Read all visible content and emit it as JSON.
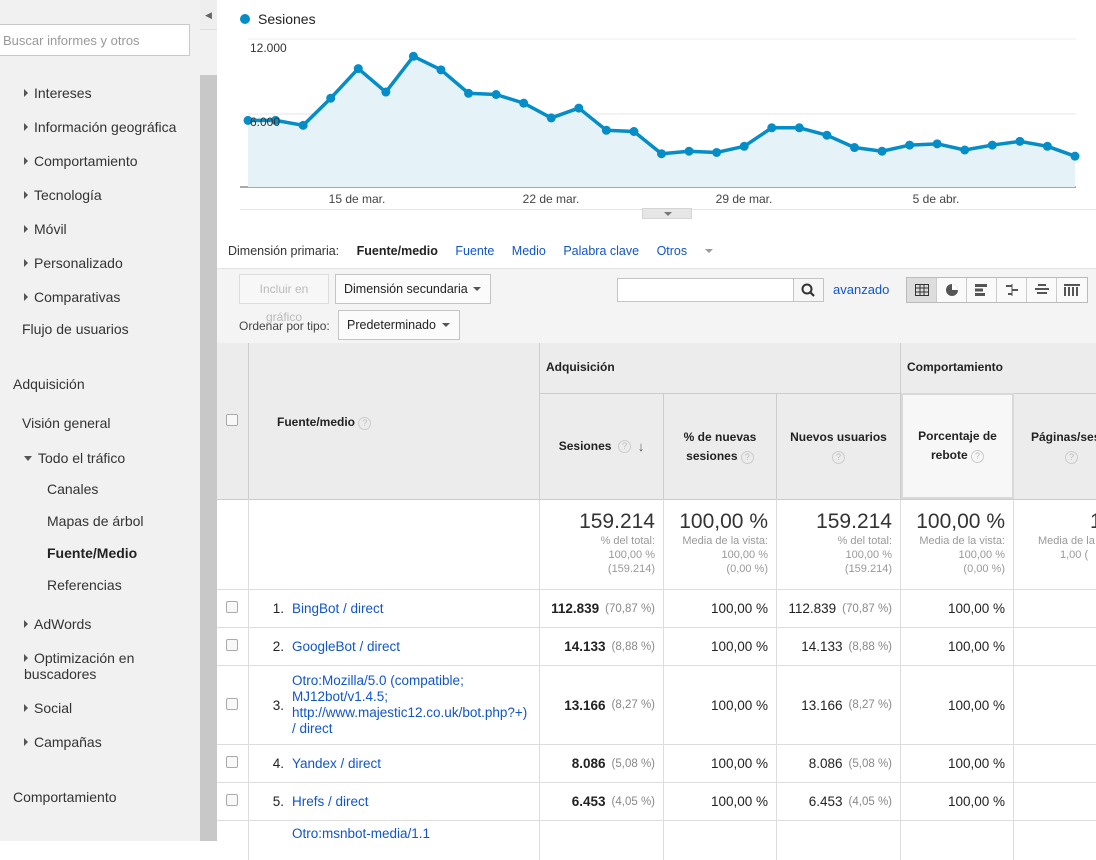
{
  "sidebar": {
    "search_placeholder": "Buscar informes y otros",
    "items": [
      {
        "label": "Intereses"
      },
      {
        "label": "Información geográfica"
      },
      {
        "label": "Comportamiento"
      },
      {
        "label": "Tecnología"
      },
      {
        "label": "Móvil"
      },
      {
        "label": "Personalizado"
      },
      {
        "label": "Comparativas"
      },
      {
        "label": "Flujo de usuarios"
      },
      {
        "label": "Adquisición"
      },
      {
        "label": "Visión general"
      },
      {
        "label": "Todo el tráfico"
      },
      {
        "label": "Canales"
      },
      {
        "label": "Mapas de árbol"
      },
      {
        "label": "Fuente/Medio"
      },
      {
        "label": "Referencias"
      },
      {
        "label": "AdWords"
      },
      {
        "label": "Optimización en buscadores"
      },
      {
        "label": "Social"
      },
      {
        "label": "Campañas"
      },
      {
        "label": "Comportamiento"
      }
    ]
  },
  "chart": {
    "legend": "Sesiones",
    "series_color": "#058dc7",
    "y_ticks": [
      "12.000",
      "6.000"
    ],
    "x_ticks": [
      "15 de mar.",
      "22 de mar.",
      "29 de mar.",
      "5 de abr."
    ]
  },
  "chart_data": {
    "type": "area",
    "series": [
      {
        "name": "Sesiones",
        "values": [
          5400,
          5400,
          5000,
          7200,
          9600,
          7700,
          10600,
          9500,
          7600,
          7500,
          6800,
          5600,
          6400,
          4600,
          4500,
          2700,
          2900,
          2800,
          3300,
          4800,
          4800,
          4200,
          3200,
          2900,
          3400,
          3500,
          3000,
          3400,
          3700,
          3300,
          2500
        ]
      }
    ],
    "x_tick_labels": [
      "15 de mar.",
      "22 de mar.",
      "29 de mar.",
      "5 de abr."
    ],
    "ylim": [
      0,
      12000
    ],
    "y_tick_labels": [
      "6.000",
      "12.000"
    ],
    "grid": true
  },
  "dimension": {
    "label": "Dimensión primaria:",
    "active": "Fuente/medio",
    "links": [
      "Fuente",
      "Medio",
      "Palabra clave",
      "Otros"
    ]
  },
  "toolbar": {
    "plot_button": "Incluir en gráfico",
    "secondary_dimension": "Dimensión secundaria",
    "advanced": "avanzado",
    "sort_label": "Ordenar por tipo:",
    "sort_value": "Predeterminado"
  },
  "table": {
    "group_acquisition": "Adquisición",
    "group_behavior": "Comportamiento",
    "col_source": "Fuente/medio",
    "col_sessions": "Sesiones",
    "col_new_pct_1": "% de nuevas",
    "col_new_pct_2": "sesiones",
    "col_new_users": "Nuevos usuarios",
    "col_bounce_1": "Porcentaje de",
    "col_bounce_2": "rebote",
    "col_pages": "Páginas/ses",
    "totals": {
      "sessions": "159.214",
      "sessions_sub1": "% del total:",
      "sessions_sub2": "100,00 %",
      "sessions_sub3": "(159.214)",
      "new_pct": "100,00 %",
      "new_pct_sub1": "Media de la vista:",
      "new_pct_sub2": "100,00 %",
      "new_pct_sub3": "(0,00 %)",
      "new_users": "159.214",
      "new_users_sub1": "% del total:",
      "new_users_sub2": "100,00 %",
      "new_users_sub3": "(159.214)",
      "bounce": "100,00 %",
      "bounce_sub1": "Media de la vista:",
      "bounce_sub2": "100,00 %",
      "bounce_sub3": "(0,00 %)",
      "pages": "1",
      "pages_sub1": "Media de la",
      "pages_sub2": "1,00 ("
    },
    "rows": [
      {
        "idx": "1.",
        "source": "BingBot / direct",
        "sessions": "112.839",
        "sessions_pct": "(70,87 %)",
        "new_pct": "100,00 %",
        "new_users": "112.839",
        "new_users_pct": "(70,87 %)",
        "bounce": "100,00 %"
      },
      {
        "idx": "2.",
        "source": "GoogleBot / direct",
        "sessions": "14.133",
        "sessions_pct": "(8,88 %)",
        "new_pct": "100,00 %",
        "new_users": "14.133",
        "new_users_pct": "(8,88 %)",
        "bounce": "100,00 %"
      },
      {
        "idx": "3.",
        "source": "Otro:Mozilla/5.0 (compatible; MJ12bot/v1.4.5; http://www.majestic12.co.uk/bot.php?+) / direct",
        "sessions": "13.166",
        "sessions_pct": "(8,27 %)",
        "new_pct": "100,00 %",
        "new_users": "13.166",
        "new_users_pct": "(8,27 %)",
        "bounce": "100,00 %"
      },
      {
        "idx": "4.",
        "source": "Yandex / direct",
        "sessions": "8.086",
        "sessions_pct": "(5,08 %)",
        "new_pct": "100,00 %",
        "new_users": "8.086",
        "new_users_pct": "(5,08 %)",
        "bounce": "100,00 %"
      },
      {
        "idx": "5.",
        "source": "Hrefs / direct",
        "sessions": "6.453",
        "sessions_pct": "(4,05 %)",
        "new_pct": "100,00 %",
        "new_users": "6.453",
        "new_users_pct": "(4,05 %)",
        "bounce": "100,00 %"
      },
      {
        "idx": "",
        "source": "Otro:msnbot-media/1.1",
        "sessions": "",
        "sessions_pct": "",
        "new_pct": "",
        "new_users": "",
        "new_users_pct": "",
        "bounce": ""
      }
    ]
  }
}
